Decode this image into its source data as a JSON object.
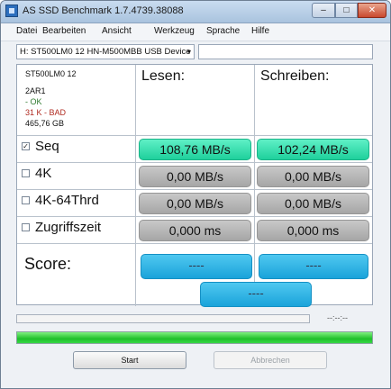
{
  "window": {
    "title": "AS SSD Benchmark 1.7.4739.38088",
    "min": "–",
    "max": "□",
    "close": "✕",
    "app_icon": "disk-icon"
  },
  "menu": [
    "Datei",
    "Bearbeiten",
    "Ansicht",
    "Werkzeug",
    "Sprache",
    "Hilfe"
  ],
  "drive_select": {
    "value": "H: ST500LM0 12 HN-M500MBB USB Device",
    "arrow": "▾"
  },
  "drive_info": {
    "model": "ST500LM0 12",
    "firmware": "2AR1",
    "status_ok": "- OK",
    "status_bad": "31 K - BAD",
    "size": "465,76 GB"
  },
  "columns": {
    "read": "Lesen:",
    "write": "Schreiben:"
  },
  "rows": [
    {
      "label": "Seq",
      "checked": true,
      "read": "108,76 MB/s",
      "write": "102,24 MB/s"
    },
    {
      "label": "4K",
      "checked": false,
      "read": "0,00 MB/s",
      "write": "0,00 MB/s"
    },
    {
      "label": "4K-64Thrd",
      "checked": false,
      "read": "0,00 MB/s",
      "write": "0,00 MB/s"
    },
    {
      "label": "Zugriffszeit",
      "checked": false,
      "read": "0,000 ms",
      "write": "0,000 ms"
    }
  ],
  "score": {
    "label": "Score:",
    "read": "----",
    "write": "----",
    "total": "----"
  },
  "progress": {
    "time_readout": "--:--:--",
    "overall_fraction": 1.0
  },
  "buttons": {
    "start": "Start",
    "abort": "Abbrechen"
  },
  "colors": {
    "green_result": "#1fd09c",
    "gray_result": "#a6a6a6",
    "score_blue": "#1aa3da",
    "progress_green": "#1fbf2b"
  }
}
